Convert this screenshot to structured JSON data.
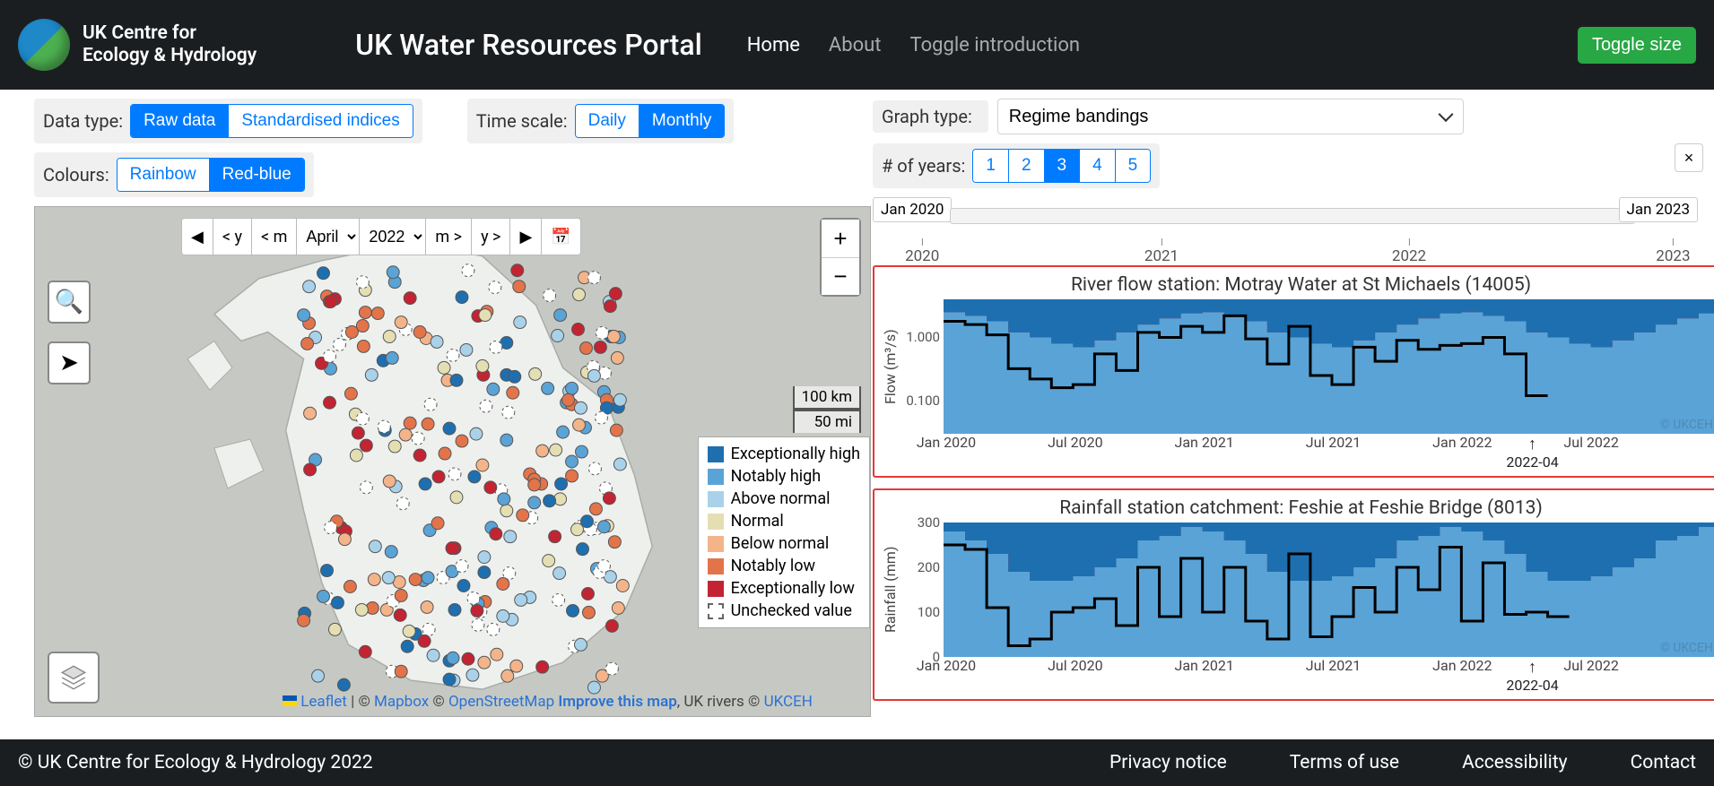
{
  "header": {
    "org_line1": "UK Centre for",
    "org_line2": "Ecology & Hydrology",
    "app_title": "UK Water Resources Portal",
    "nav": {
      "home": "Home",
      "about": "About",
      "toggle_intro": "Toggle introduction"
    },
    "toggle_size": "Toggle size"
  },
  "controls": {
    "data_type_label": "Data type:",
    "data_type": {
      "raw": "Raw data",
      "std": "Standardised indices"
    },
    "time_scale_label": "Time scale:",
    "time_scale": {
      "daily": "Daily",
      "monthly": "Monthly"
    },
    "colours_label": "Colours:",
    "colours": {
      "rainbow": "Rainbow",
      "redblue": "Red-blue"
    },
    "graph_type_label": "Graph type:",
    "graph_type_value": "Regime bandings",
    "years_label": "# of years:",
    "years": {
      "y1": "1",
      "y2": "2",
      "y3": "3",
      "y4": "4",
      "y5": "5"
    }
  },
  "date_bar": {
    "prev_year": "< y",
    "prev_month": "< m",
    "month": "April",
    "year": "2022",
    "next_month": "m >",
    "next_year": "y >"
  },
  "map": {
    "scale_km": "100 km",
    "scale_mi": "50 mi",
    "legend": {
      "exc_high": "Exceptionally high",
      "not_high": "Notably high",
      "above": "Above normal",
      "normal": "Normal",
      "below": "Below normal",
      "not_low": "Notably low",
      "exc_low": "Exceptionally low",
      "unchecked": "Unchecked value"
    },
    "attrib": {
      "leaflet": "Leaflet",
      "mapbox": "Mapbox",
      "osm": "OpenStreetMap",
      "improve": "Improve this map",
      "rivers": ", UK rivers © ",
      "ukceh": "UKCEH"
    },
    "legend_colors": {
      "exc_high": "#1e6fb0",
      "not_high": "#5aa3d6",
      "above": "#a9d2ea",
      "normal": "#e4dfb3",
      "below": "#f4b489",
      "not_low": "#e3744a",
      "exc_low": "#c22432"
    }
  },
  "timeline": {
    "start": "Jan 2020",
    "end": "Jan 2023",
    "ticks": {
      "t0": "2020",
      "t1": "2021",
      "t2": "2022",
      "t3": "2023"
    }
  },
  "chart_data": [
    {
      "type": "area",
      "title": "River flow station: Motray Water at St Michaels (14005)",
      "ylabel": "Flow (m³/s)",
      "yscale": "log",
      "yticks": [
        0.1,
        1.0
      ],
      "ytick_labels": [
        "0.100",
        "1.000"
      ],
      "ylim": [
        0.03,
        4.0
      ],
      "x": [
        "Jan 2020",
        "Feb 2020",
        "Mar 2020",
        "Apr 2020",
        "May 2020",
        "Jun 2020",
        "Jul 2020",
        "Aug 2020",
        "Sep 2020",
        "Oct 2020",
        "Nov 2020",
        "Dec 2020",
        "Jan 2021",
        "Feb 2021",
        "Mar 2021",
        "Apr 2021",
        "May 2021",
        "Jun 2021",
        "Jul 2021",
        "Aug 2021",
        "Sep 2021",
        "Oct 2021",
        "Nov 2021",
        "Dec 2021",
        "Jan 2022",
        "Feb 2022",
        "Mar 2022",
        "Apr 2022",
        "May 2022",
        "Jun 2022",
        "Jul 2022",
        "Aug 2022",
        "Sep 2022",
        "Oct 2022",
        "Nov 2022",
        "Dec 2022"
      ],
      "xtick_labels": [
        "Jan 2020",
        "Jul 2020",
        "Jan 2021",
        "Jul 2021",
        "Jan 2022",
        "Jul 2022"
      ],
      "observed": [
        1.8,
        1.6,
        1.1,
        0.32,
        0.22,
        0.16,
        0.18,
        0.55,
        0.3,
        1.2,
        1.0,
        1.5,
        1.2,
        2.2,
        0.95,
        0.38,
        1.5,
        0.25,
        0.18,
        0.7,
        0.42,
        0.9,
        0.65,
        0.75,
        0.8,
        1.0,
        0.55,
        0.12,
        null,
        null,
        null,
        null,
        null,
        null,
        null,
        null
      ],
      "bands": {
        "p95": [
          2.5,
          2.2,
          1.8,
          1.2,
          1.0,
          0.8,
          0.7,
          0.9,
          1.2,
          1.6,
          2.0,
          2.4,
          2.5,
          2.2,
          1.8,
          1.2,
          1.0,
          0.8,
          0.7,
          0.9,
          1.2,
          1.6,
          2.0,
          2.4,
          2.5,
          2.2,
          1.8,
          1.2,
          1.0,
          0.8,
          0.7,
          0.9,
          1.2,
          1.6,
          2.0,
          2.4
        ],
        "p75": [
          1.6,
          1.4,
          1.1,
          0.7,
          0.55,
          0.45,
          0.4,
          0.5,
          0.7,
          1.0,
          1.3,
          1.5,
          1.6,
          1.4,
          1.1,
          0.7,
          0.55,
          0.45,
          0.4,
          0.5,
          0.7,
          1.0,
          1.3,
          1.5,
          1.6,
          1.4,
          1.1,
          0.7,
          0.55,
          0.45,
          0.4,
          0.5,
          0.7,
          1.0,
          1.3,
          1.5
        ],
        "p50": [
          0.9,
          0.8,
          0.6,
          0.4,
          0.3,
          0.25,
          0.22,
          0.28,
          0.4,
          0.6,
          0.75,
          0.85,
          0.9,
          0.8,
          0.6,
          0.4,
          0.3,
          0.25,
          0.22,
          0.28,
          0.4,
          0.6,
          0.75,
          0.85,
          0.9,
          0.8,
          0.6,
          0.4,
          0.3,
          0.25,
          0.22,
          0.28,
          0.4,
          0.6,
          0.75,
          0.85
        ],
        "p25": [
          0.45,
          0.4,
          0.3,
          0.2,
          0.15,
          0.12,
          0.11,
          0.14,
          0.2,
          0.3,
          0.38,
          0.43,
          0.45,
          0.4,
          0.3,
          0.2,
          0.15,
          0.12,
          0.11,
          0.14,
          0.2,
          0.3,
          0.38,
          0.43,
          0.45,
          0.4,
          0.3,
          0.2,
          0.15,
          0.12,
          0.11,
          0.14,
          0.2,
          0.3,
          0.38,
          0.43
        ],
        "p5": [
          0.18,
          0.16,
          0.12,
          0.08,
          0.06,
          0.05,
          0.045,
          0.055,
          0.08,
          0.12,
          0.15,
          0.17,
          0.18,
          0.16,
          0.12,
          0.08,
          0.06,
          0.05,
          0.045,
          0.055,
          0.08,
          0.12,
          0.15,
          0.17,
          0.18,
          0.16,
          0.12,
          0.08,
          0.06,
          0.05,
          0.045,
          0.055,
          0.08,
          0.12,
          0.15,
          0.17
        ]
      },
      "marker": "2022-04",
      "watermark": "© UKCEH"
    },
    {
      "type": "area",
      "title": "Rainfall station catchment: Feshie at Feshie Bridge (8013)",
      "ylabel": "Rainfall (mm)",
      "yscale": "linear",
      "yticks": [
        0,
        100,
        200,
        300
      ],
      "ytick_labels": [
        "0",
        "100",
        "200",
        "300"
      ],
      "ylim": [
        0,
        300
      ],
      "x": [
        "Jan 2020",
        "Feb 2020",
        "Mar 2020",
        "Apr 2020",
        "May 2020",
        "Jun 2020",
        "Jul 2020",
        "Aug 2020",
        "Sep 2020",
        "Oct 2020",
        "Nov 2020",
        "Dec 2020",
        "Jan 2021",
        "Feb 2021",
        "Mar 2021",
        "Apr 2021",
        "May 2021",
        "Jun 2021",
        "Jul 2021",
        "Aug 2021",
        "Sep 2021",
        "Oct 2021",
        "Nov 2021",
        "Dec 2021",
        "Jan 2022",
        "Feb 2022",
        "Mar 2022",
        "Apr 2022",
        "May 2022",
        "Jun 2022",
        "Jul 2022",
        "Aug 2022",
        "Sep 2022",
        "Oct 2022",
        "Nov 2022",
        "Dec 2022"
      ],
      "xtick_labels": [
        "Jan 2020",
        "Jul 2020",
        "Jan 2021",
        "Jul 2021",
        "Jan 2022",
        "Jul 2022"
      ],
      "observed": [
        250,
        240,
        110,
        25,
        40,
        100,
        110,
        130,
        70,
        200,
        90,
        220,
        100,
        200,
        80,
        40,
        230,
        45,
        90,
        155,
        100,
        200,
        150,
        245,
        80,
        210,
        95,
        100,
        90,
        null,
        null,
        null,
        null,
        null,
        null,
        null
      ],
      "bands": {
        "p95": [
          280,
          260,
          230,
          190,
          170,
          170,
          180,
          200,
          220,
          260,
          270,
          290,
          280,
          260,
          230,
          190,
          170,
          170,
          180,
          200,
          220,
          260,
          270,
          290,
          280,
          260,
          230,
          190,
          170,
          170,
          180,
          200,
          220,
          260,
          270,
          290
        ],
        "p75": [
          210,
          195,
          170,
          140,
          125,
          125,
          135,
          150,
          165,
          195,
          205,
          220,
          210,
          195,
          170,
          140,
          125,
          125,
          135,
          150,
          165,
          195,
          205,
          220,
          210,
          195,
          170,
          140,
          125,
          125,
          135,
          150,
          165,
          195,
          205,
          220
        ],
        "p50": [
          150,
          140,
          120,
          100,
          90,
          90,
          95,
          105,
          115,
          140,
          150,
          160,
          150,
          140,
          120,
          100,
          90,
          90,
          95,
          105,
          115,
          140,
          150,
          160,
          150,
          140,
          120,
          100,
          90,
          90,
          95,
          105,
          115,
          140,
          150,
          160
        ],
        "p25": [
          95,
          90,
          78,
          65,
          58,
          58,
          62,
          68,
          75,
          90,
          97,
          103,
          95,
          90,
          78,
          65,
          58,
          58,
          62,
          68,
          75,
          90,
          97,
          103,
          95,
          90,
          78,
          65,
          58,
          58,
          62,
          68,
          75,
          90,
          97,
          103
        ],
        "p5": [
          45,
          42,
          36,
          30,
          27,
          27,
          29,
          32,
          35,
          42,
          45,
          48,
          45,
          42,
          36,
          30,
          27,
          27,
          29,
          32,
          35,
          42,
          45,
          48,
          45,
          42,
          36,
          30,
          27,
          27,
          29,
          32,
          35,
          42,
          45,
          48
        ]
      },
      "marker": "2022-04",
      "watermark": "© UKCEH"
    }
  ],
  "footer": {
    "copy": "© UK Centre for Ecology & Hydrology 2022",
    "privacy": "Privacy notice",
    "terms": "Terms of use",
    "access": "Accessibility",
    "contact": "Contact"
  }
}
